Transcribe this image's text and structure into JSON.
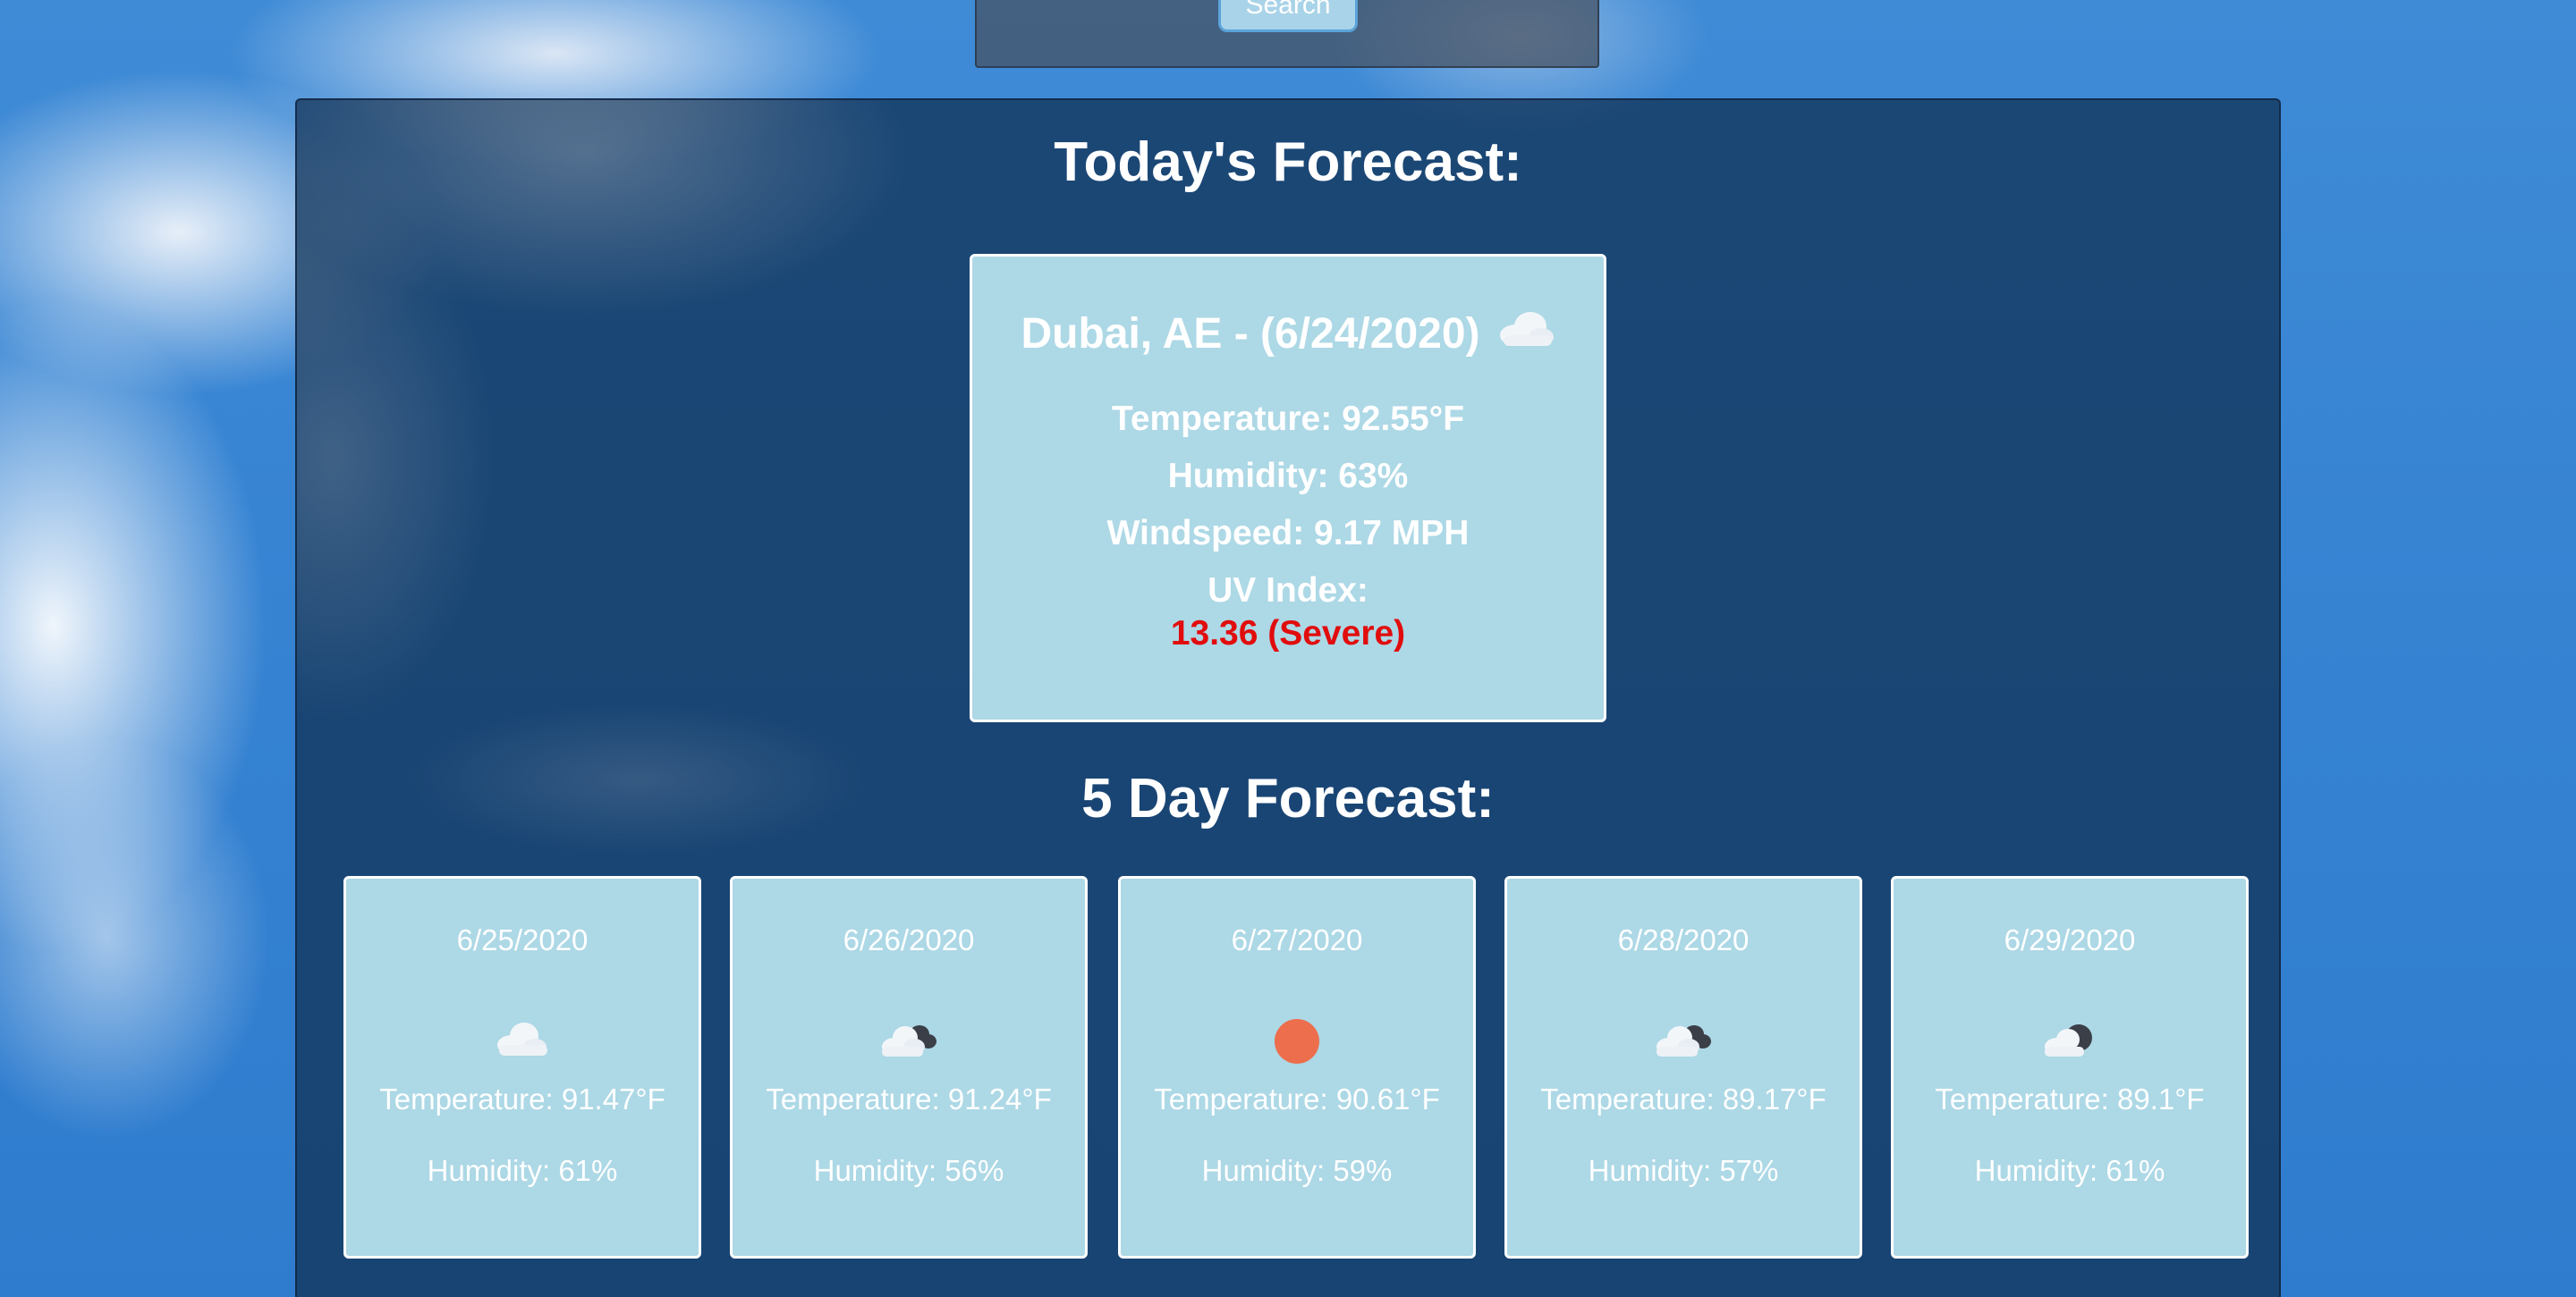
{
  "search": {
    "button_label": "Search"
  },
  "today": {
    "section_title": "Today's Forecast:",
    "heading": "Dubai, AE - (6/24/2020)",
    "icon": "cloud-icon",
    "temperature": "Temperature: 92.55°F",
    "humidity": "Humidity: 63%",
    "windspeed": "Windspeed: 9.17 MPH",
    "uv_label": "UV Index:",
    "uv_value": "13.36 (Severe)"
  },
  "five_day": {
    "section_title": "5 Day Forecast:",
    "days": [
      {
        "date": "6/25/2020",
        "icon": "cloud-icon",
        "temperature": "Temperature: 91.47°F",
        "humidity": "Humidity: 61%"
      },
      {
        "date": "6/26/2020",
        "icon": "broken-clouds-icon",
        "temperature": "Temperature: 91.24°F",
        "humidity": "Humidity: 56%"
      },
      {
        "date": "6/27/2020",
        "icon": "sun-icon",
        "temperature": "Temperature: 90.61°F",
        "humidity": "Humidity: 59%"
      },
      {
        "date": "6/28/2020",
        "icon": "broken-clouds-icon",
        "temperature": "Temperature: 89.17°F",
        "humidity": "Humidity: 57%"
      },
      {
        "date": "6/29/2020",
        "icon": "partly-cloudy-night-icon",
        "temperature": "Temperature: 89.1°F",
        "humidity": "Humidity: 61%"
      }
    ]
  },
  "colors": {
    "card_bg": "#add8e6",
    "panel_bg": "#12345a",
    "uv_severe": "#e10d0d",
    "sun": "#ec6e4c"
  }
}
